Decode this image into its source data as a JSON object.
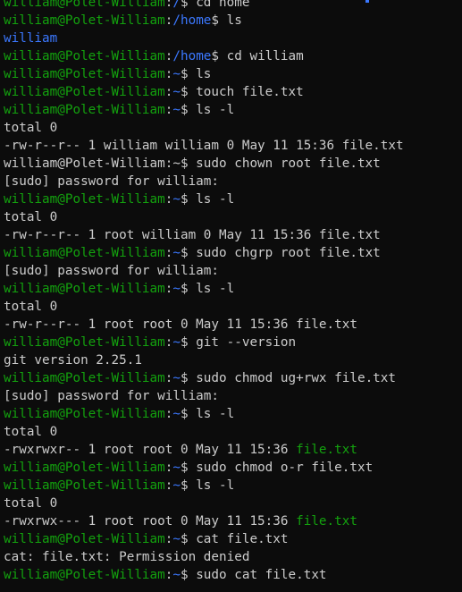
{
  "terminal": {
    "lines": [
      {
        "type": "prompt",
        "user": "william@Polet-William",
        "path": "/",
        "cmd": "cd home"
      },
      {
        "type": "prompt",
        "user": "william@Polet-William",
        "path": "/home",
        "cmd": "ls"
      },
      {
        "type": "output-dir",
        "text": "william"
      },
      {
        "type": "prompt",
        "user": "william@Polet-William",
        "path": "/home",
        "cmd": "cd william"
      },
      {
        "type": "prompt",
        "user": "william@Polet-William",
        "path": "~",
        "cmd": "ls"
      },
      {
        "type": "prompt",
        "user": "william@Polet-William",
        "path": "~",
        "cmd": "touch file.txt"
      },
      {
        "type": "prompt",
        "user": "william@Polet-William",
        "path": "~",
        "cmd": "ls -l"
      },
      {
        "type": "output",
        "text": "total 0"
      },
      {
        "type": "output",
        "text": "-rw-r--r-- 1 william william 0 May 11 15:36 file.txt"
      },
      {
        "type": "prompt-plain",
        "text": "william@Polet-William:~$ sudo chown root file.txt"
      },
      {
        "type": "output",
        "text": "[sudo] password for william:"
      },
      {
        "type": "prompt",
        "user": "william@Polet-William",
        "path": "~",
        "cmd": "ls -l"
      },
      {
        "type": "output",
        "text": "total 0"
      },
      {
        "type": "output",
        "text": "-rw-r--r-- 1 root william 0 May 11 15:36 file.txt"
      },
      {
        "type": "prompt",
        "user": "william@Polet-William",
        "path": "~",
        "cmd": "sudo chgrp root file.txt"
      },
      {
        "type": "output",
        "text": "[sudo] password for william:"
      },
      {
        "type": "prompt",
        "user": "william@Polet-William",
        "path": "~",
        "cmd": "ls -l"
      },
      {
        "type": "output",
        "text": "total 0"
      },
      {
        "type": "output",
        "text": "-rw-r--r-- 1 root root 0 May 11 15:36 file.txt"
      },
      {
        "type": "prompt",
        "user": "william@Polet-William",
        "path": "~",
        "cmd": "git --version"
      },
      {
        "type": "output",
        "text": "git version 2.25.1"
      },
      {
        "type": "prompt",
        "user": "william@Polet-William",
        "path": "~",
        "cmd": "sudo chmod ug+rwx file.txt"
      },
      {
        "type": "output",
        "text": "[sudo] password for william:"
      },
      {
        "type": "prompt",
        "user": "william@Polet-William",
        "path": "~",
        "cmd": "ls -l"
      },
      {
        "type": "output",
        "text": "total 0"
      },
      {
        "type": "output-exec",
        "prefix": "-rwxrwxr-- 1 root root 0 May 11 15:36 ",
        "file": "file.txt"
      },
      {
        "type": "prompt",
        "user": "william@Polet-William",
        "path": "~",
        "cmd": "sudo chmod o-r file.txt"
      },
      {
        "type": "prompt",
        "user": "william@Polet-William",
        "path": "~",
        "cmd": "ls -l"
      },
      {
        "type": "output",
        "text": "total 0"
      },
      {
        "type": "output-exec",
        "prefix": "-rwxrwx--- 1 root root 0 May 11 15:36 ",
        "file": "file.txt"
      },
      {
        "type": "prompt",
        "user": "william@Polet-William",
        "path": "~",
        "cmd": "cat file.txt"
      },
      {
        "type": "output",
        "text": "cat: file.txt: Permission denied"
      },
      {
        "type": "prompt",
        "user": "william@Polet-William",
        "path": "~",
        "cmd": "sudo cat file.txt"
      }
    ]
  },
  "colors": {
    "background": "#0c0c0c",
    "prompt_user": "#13a10e",
    "prompt_path": "#3b78ff",
    "text": "#cccccc",
    "executable": "#13a10e",
    "directory": "#3b78ff"
  }
}
